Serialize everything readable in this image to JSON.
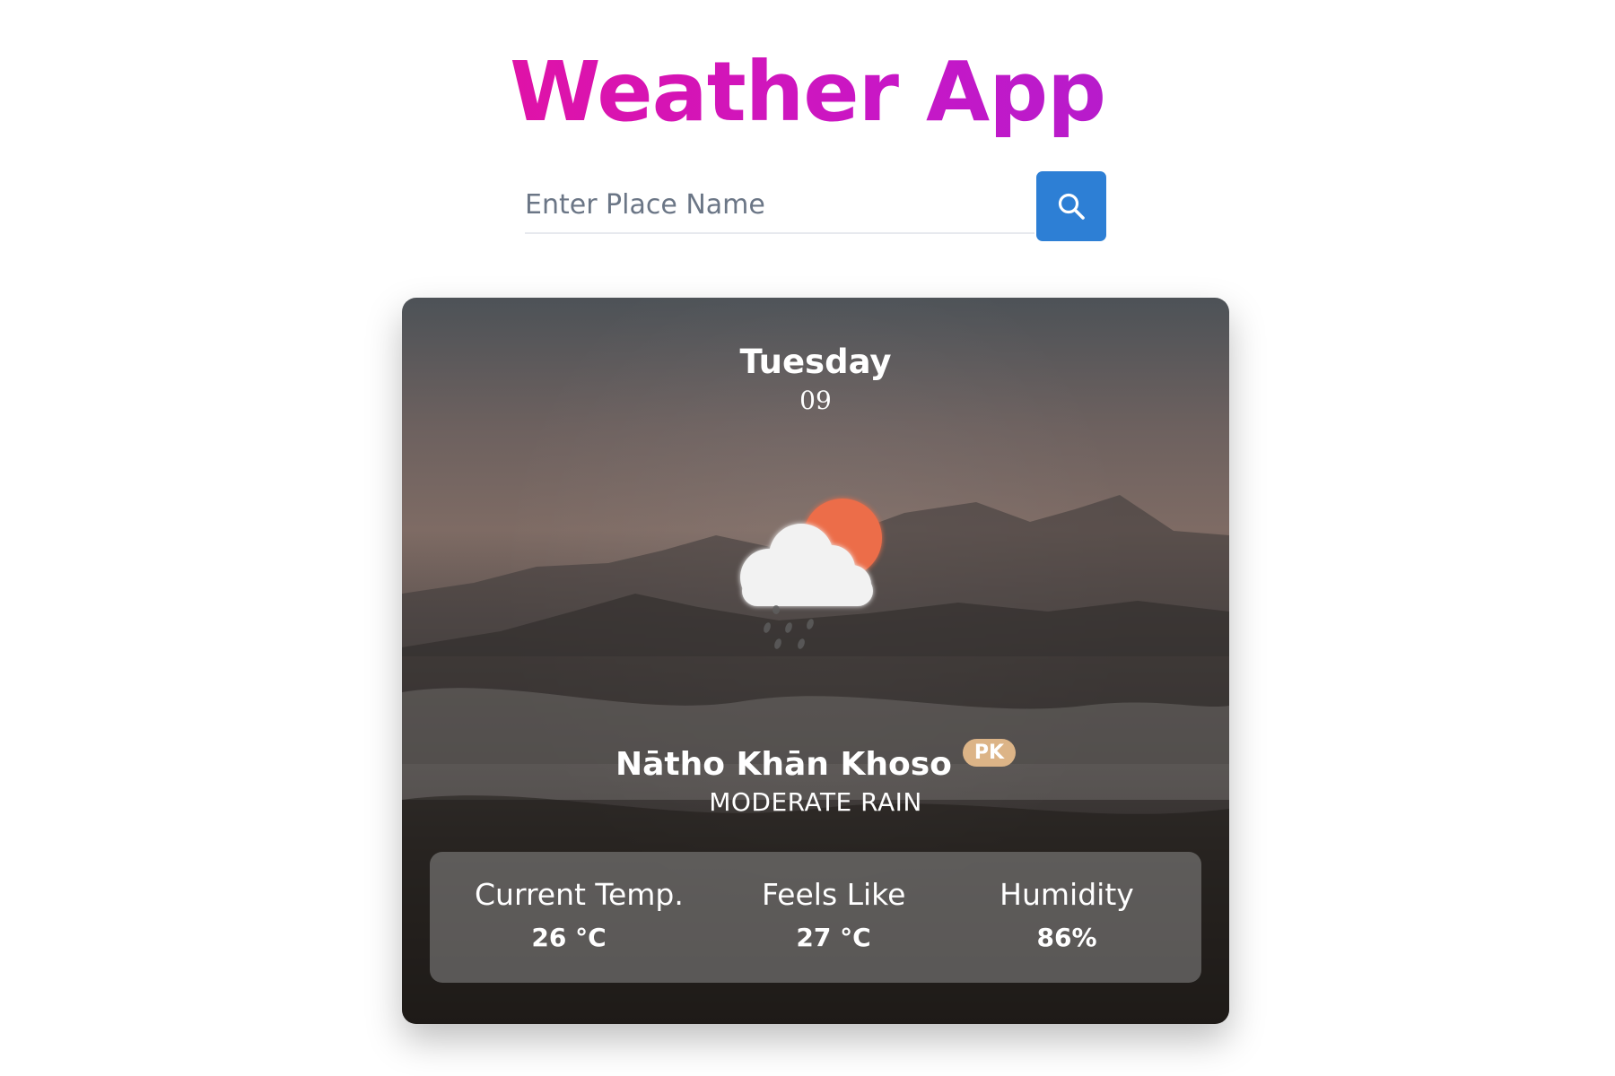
{
  "header": {
    "title": "Weather App"
  },
  "search": {
    "placeholder": "Enter Place Name",
    "value": "",
    "button_icon": "search-icon"
  },
  "card": {
    "day": "Tuesday",
    "date": "09",
    "weather_icon": "cloud-sun-rain-icon",
    "location": "Nāthо Khān Khoso",
    "country": "PK",
    "condition": "MODERATE RAIN",
    "stats": [
      {
        "label": "Current Temp.",
        "value": "26 °C"
      },
      {
        "label": "Feels Like",
        "value": "27 °C"
      },
      {
        "label": "Humidity",
        "value": "86%"
      }
    ]
  },
  "colors": {
    "title_gradient": [
      "#ff0c7e",
      "#8e26d8"
    ],
    "search_button": "#2d7fd5",
    "badge": "#dcb487",
    "sun": "#ec6d4a"
  }
}
